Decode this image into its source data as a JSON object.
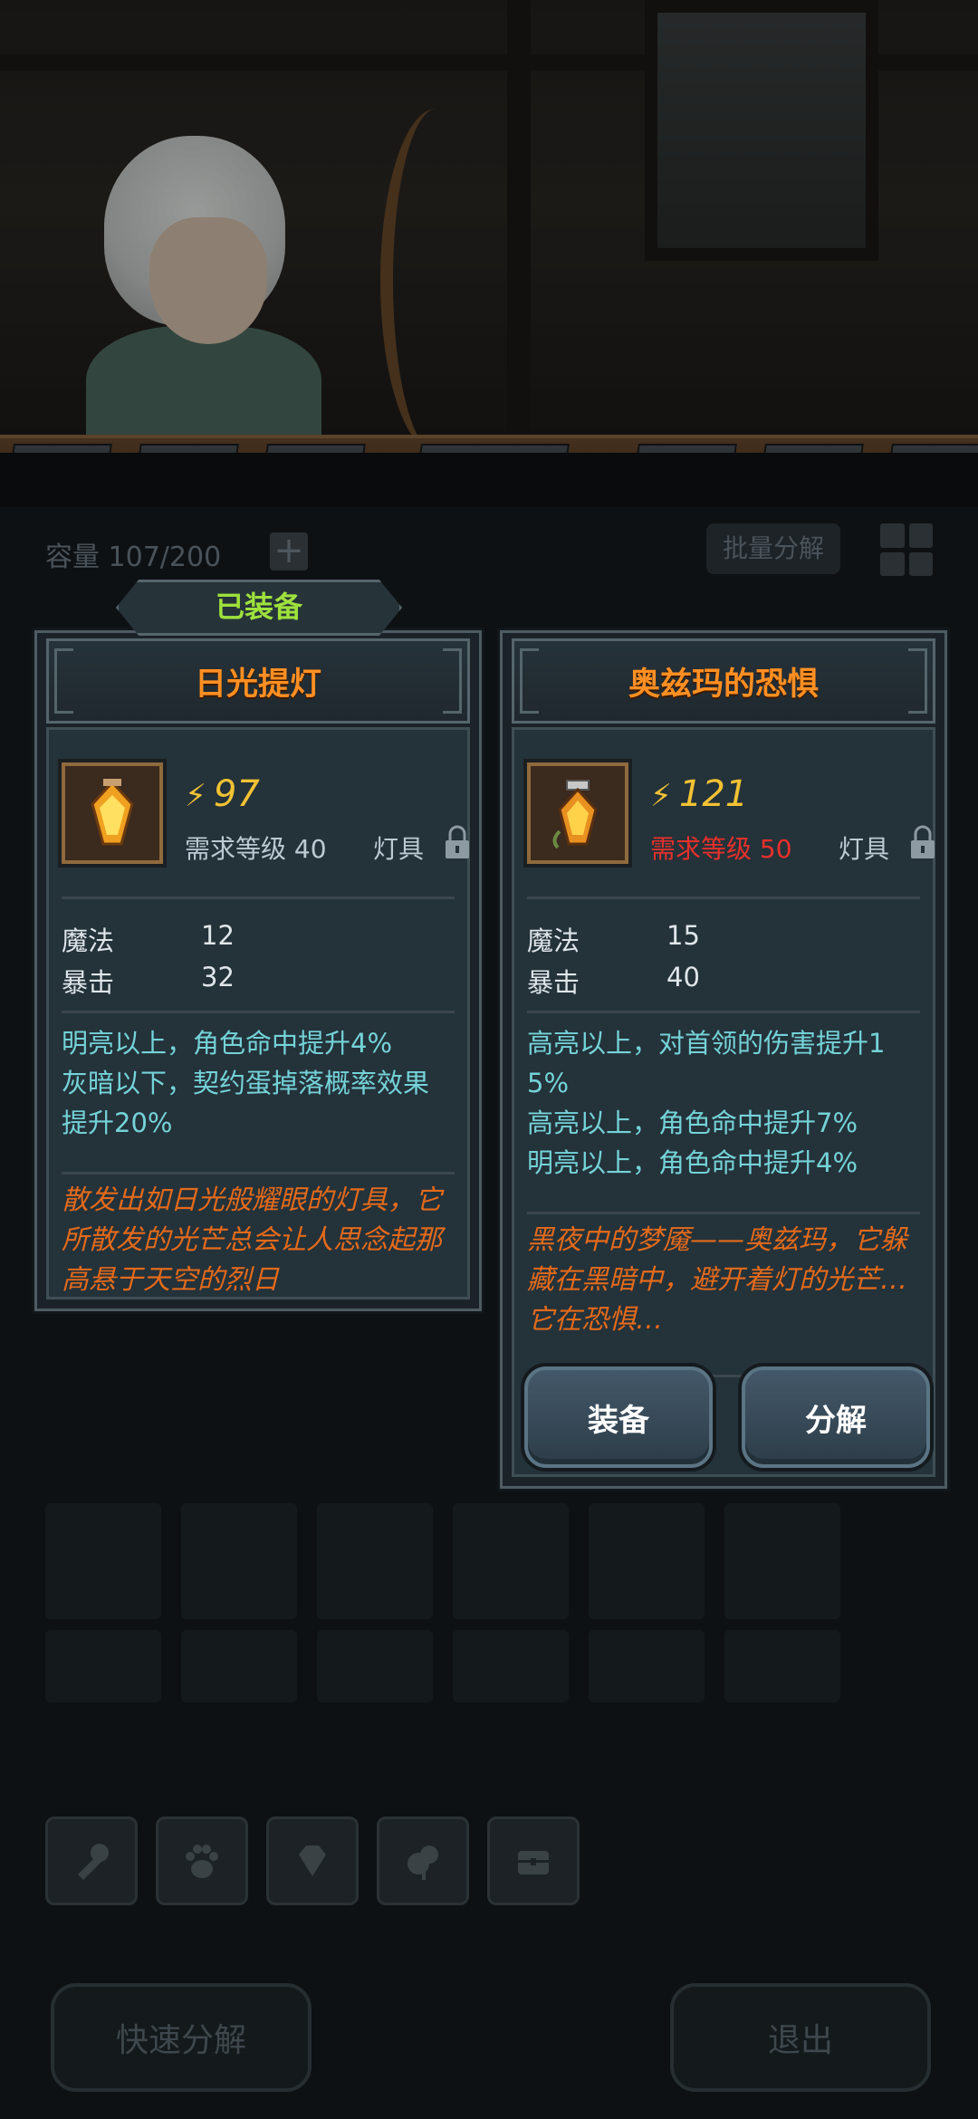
{
  "inventory": {
    "capacity_label": "容量 107/200",
    "add_label": "+",
    "batch_label": "批量分解"
  },
  "equipped_tag": "已装备",
  "left_card": {
    "title": "日光提灯",
    "power_symbol": "⚡",
    "power": "97",
    "requirement": "需求等级 40",
    "type": "灯具",
    "stats": [
      {
        "label": "魔法",
        "value": "12"
      },
      {
        "label": "暴击",
        "value": "32"
      }
    ],
    "effects": [
      "明亮以上，角色命中提升4%",
      "灰暗以下，契约蛋掉落概率效果提升20%"
    ],
    "flavor": "散发出如日光般耀眼的灯具，它所散发的光芒总会让人思念起那高悬于天空的烈日"
  },
  "right_card": {
    "title": "奥兹玛的恐惧",
    "power_symbol": "⚡",
    "power": "121",
    "requirement": "需求等级 50",
    "requirement_color": "#e7302a",
    "type": "灯具",
    "stats": [
      {
        "label": "魔法",
        "value": "15"
      },
      {
        "label": "暴击",
        "value": "40"
      }
    ],
    "effects": [
      "高亮以上，对首领的伤害提升15%",
      "高亮以上，角色命中提升7%",
      "明亮以上，角色命中提升4%"
    ],
    "flavor": "黑夜中的梦魇——奥兹玛，它躲藏在黑暗中，避开着灯的光芒…它在恐惧…",
    "equip_label": "装备",
    "dismantle_label": "分解"
  },
  "bottom": {
    "quick_dismantle_label": "快速分解",
    "exit_label": "退出",
    "tools": [
      "tool-icon",
      "paw-icon",
      "gem-icon",
      "leaf-icon",
      "chest-icon"
    ]
  },
  "colors": {
    "title": "#ff8f22",
    "power": "#f2c233",
    "effect": "#74d3d8",
    "flavor": "#e46a1a",
    "equipped": "#9ee13c"
  }
}
